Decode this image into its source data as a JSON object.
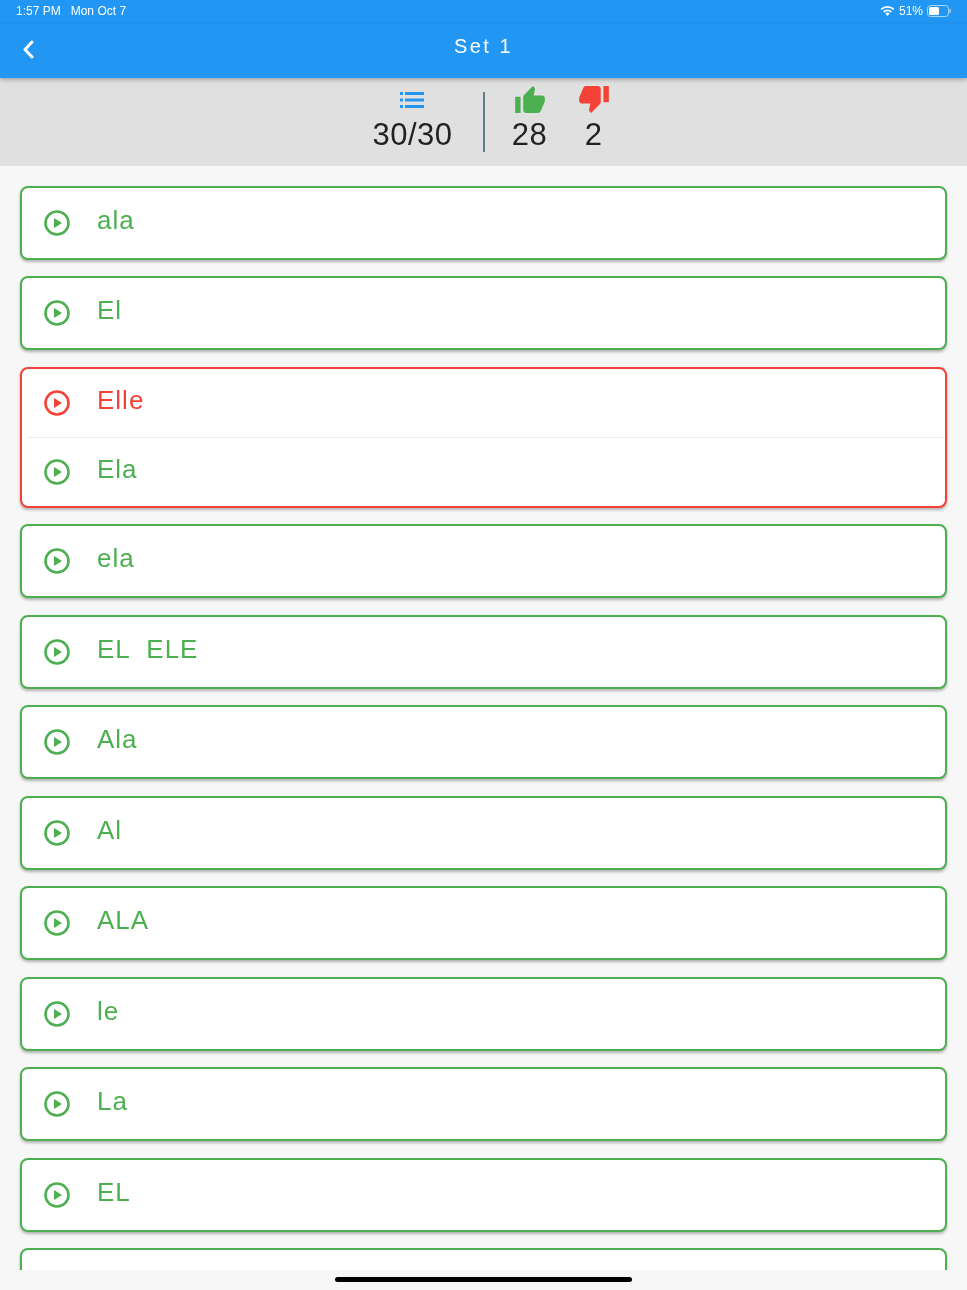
{
  "status_bar": {
    "time": "1:57 PM",
    "date": "Mon Oct 7",
    "battery": "51%"
  },
  "app_bar": {
    "title": "Set 1"
  },
  "stats": {
    "total": "30/30",
    "correct": "28",
    "wrong": "2"
  },
  "cards": [
    {
      "correct": true,
      "lines": [
        {
          "text": "ala",
          "correct": true
        }
      ]
    },
    {
      "correct": true,
      "lines": [
        {
          "text": "El",
          "correct": true
        }
      ]
    },
    {
      "correct": false,
      "lines": [
        {
          "text": "Elle",
          "correct": false
        },
        {
          "text": "Ela",
          "correct": true
        }
      ]
    },
    {
      "correct": true,
      "lines": [
        {
          "text": "ela",
          "correct": true
        }
      ]
    },
    {
      "correct": true,
      "lines": [
        {
          "text": "EL  ELE",
          "correct": true
        }
      ]
    },
    {
      "correct": true,
      "lines": [
        {
          "text": "Ala",
          "correct": true
        }
      ]
    },
    {
      "correct": true,
      "lines": [
        {
          "text": "Al",
          "correct": true
        }
      ]
    },
    {
      "correct": true,
      "lines": [
        {
          "text": "ALA",
          "correct": true
        }
      ]
    },
    {
      "correct": true,
      "lines": [
        {
          "text": "le",
          "correct": true
        }
      ]
    },
    {
      "correct": true,
      "lines": [
        {
          "text": "La",
          "correct": true
        }
      ]
    },
    {
      "correct": true,
      "lines": [
        {
          "text": "EL",
          "correct": true
        }
      ]
    },
    {
      "correct": true
    }
  ]
}
